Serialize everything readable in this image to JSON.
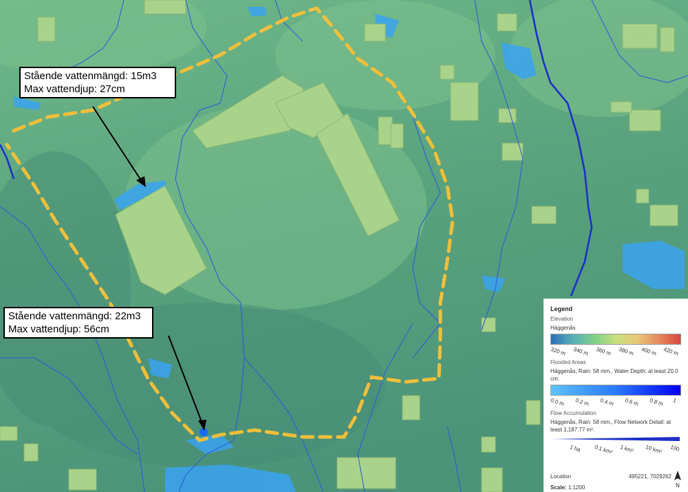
{
  "callouts": [
    {
      "line1": "Stående vattenmängd: 15m3",
      "line2": "Max vattendjup: 27cm"
    },
    {
      "line1": "Stående vattenmängd: 22m3",
      "line2": "Max vattendjup: 56cm"
    }
  ],
  "legend": {
    "title": "Legend",
    "elevation": {
      "heading": "Elevation",
      "name": "Häggenås",
      "ticks": [
        "320 m",
        "340 m",
        "360 m",
        "380 m",
        "400 m",
        "420 m"
      ]
    },
    "flooded": {
      "heading": "Flooded Areas",
      "description": "Häggenås, Rain: 58 mm., Water Depth: at least 20.0 cm.",
      "ticks": [
        "0.0 m",
        "0.2 m",
        "0.4 m",
        "0.6 m",
        "0.8 m",
        "1"
      ]
    },
    "flow": {
      "heading": "Flow Accumulation",
      "description": "Häggenås, Rain: 58 mm., Flow Network Detail: at least 1,187.77 m².",
      "ticks": [
        "1 ha",
        "0.1 km²",
        "1 km²",
        "10 km²",
        "100"
      ]
    },
    "location_label": "Location",
    "location_value": "495221, 7029262",
    "scale_label": "Scale:",
    "scale_value": "1:1200",
    "north_label": "N"
  },
  "colors": {
    "terrain": "#5fa67f",
    "building": "#a9d38a",
    "boundary": "#f2bf3a",
    "flow": "#2a55d6",
    "flood": "#3aa3f0"
  }
}
